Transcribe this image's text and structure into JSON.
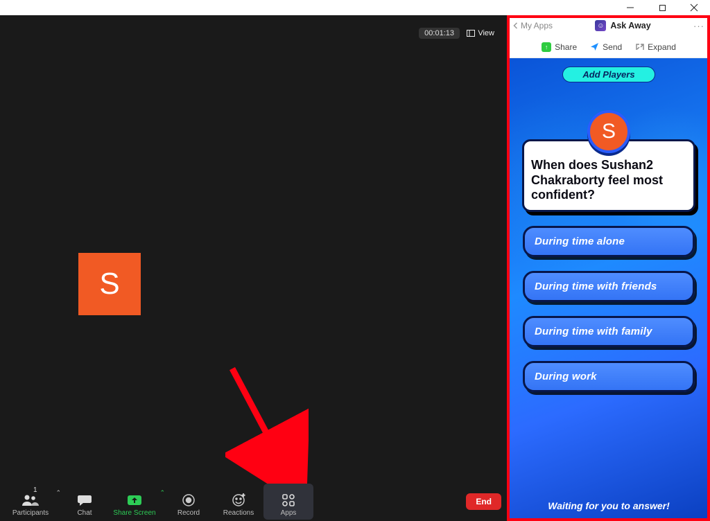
{
  "window": {
    "minimize": "—",
    "restore": "❐",
    "close": "×"
  },
  "meeting": {
    "timer": "00:01:13",
    "view_label": "View",
    "avatar_initial": "S",
    "end_label": "End"
  },
  "toolbar": {
    "participants": {
      "label": "Participants",
      "count": "1"
    },
    "chat": "Chat",
    "share": "Share Screen",
    "record": "Record",
    "reactions": "Reactions",
    "apps": "Apps"
  },
  "panel": {
    "back": "My Apps",
    "title": "Ask Away",
    "more": "···",
    "share": "Share",
    "send": "Send",
    "expand": "Expand"
  },
  "game": {
    "add_players": "Add Players",
    "avatar_initial": "S",
    "question": "When does Sushan2 Chakraborty feel most confident?",
    "answers": [
      "During time alone",
      "During time with friends",
      "During time with family",
      "During work"
    ],
    "waiting": "Waiting for you to answer!"
  },
  "colors": {
    "accent_red": "#ff0012",
    "zoom_green": "#2dcc56",
    "tile_orange": "#f15a24"
  }
}
